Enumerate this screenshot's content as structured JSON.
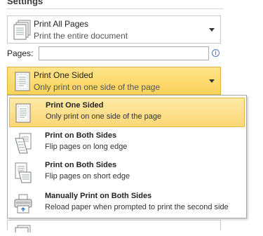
{
  "header": {
    "title": "Settings"
  },
  "print_range": {
    "title": "Print All Pages",
    "subtitle": "Print the entire document",
    "icon": "pages-stack-icon"
  },
  "pages": {
    "label": "Pages:",
    "value": "",
    "placeholder": "",
    "info_icon": "info-icon",
    "info_glyph": "i"
  },
  "sides": {
    "title": "Print One Sided",
    "subtitle": "Only print on one side of the page",
    "icon": "one-sided-page-icon"
  },
  "sides_menu": {
    "items": [
      {
        "title": "Print One Sided",
        "subtitle": "Only print on one side of the page",
        "icon": "one-sided-page-icon",
        "selected": true
      },
      {
        "title": "Print on Both Sides",
        "subtitle": "Flip pages on long edge",
        "icon": "flip-long-edge-icon",
        "selected": false
      },
      {
        "title": "Print on Both Sides",
        "subtitle": "Flip pages on short edge",
        "icon": "flip-short-edge-icon",
        "selected": false
      },
      {
        "title": "Manually Print on Both Sides",
        "subtitle": "Reload paper when prompted to print the second side",
        "icon": "manual-duplex-printer-icon",
        "selected": false
      }
    ]
  },
  "colors": {
    "selected_bg": "#fbd35a",
    "selected_border": "#e2b13c",
    "info_blue": "#4f7fc4"
  }
}
